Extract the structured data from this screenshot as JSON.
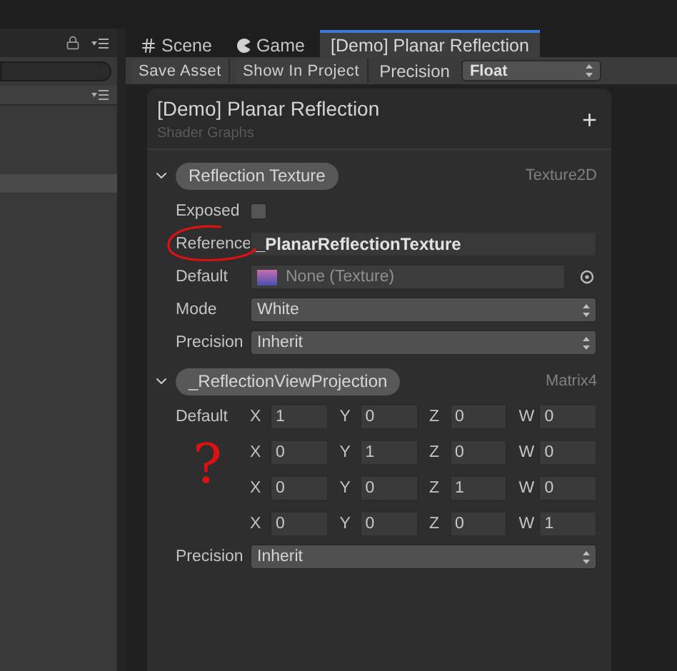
{
  "tabs": [
    {
      "label": "Scene",
      "kind": "scene",
      "selected": false
    },
    {
      "label": "Game",
      "kind": "game",
      "selected": false
    },
    {
      "label": "[Demo] Planar Reflection",
      "kind": "graph",
      "selected": true
    }
  ],
  "toolbar": {
    "buttons": [
      "Save Asset",
      "Show In Project"
    ],
    "precision_label": "Precision",
    "precision_value": "Float"
  },
  "blackboard": {
    "title": "[Demo] Planar Reflection",
    "subtitle": "Shader Graphs",
    "add_label": "+",
    "properties": [
      {
        "name": "Reflection Texture",
        "type": "Texture2D",
        "expanded": true,
        "fields": [
          {
            "kind": "checkbox",
            "label": "Exposed",
            "checked": false
          },
          {
            "kind": "text",
            "label": "Reference",
            "value": "_PlanarReflectionTexture",
            "circled": true
          },
          {
            "kind": "object",
            "label": "Default",
            "value": "None (Texture)"
          },
          {
            "kind": "dropdown",
            "label": "Mode",
            "value": "White"
          },
          {
            "kind": "dropdown",
            "label": "Precision",
            "value": "Inherit"
          }
        ]
      },
      {
        "name": "_ReflectionViewProjection",
        "type": "Matrix4",
        "expanded": true,
        "fields": [
          {
            "kind": "matrix",
            "label": "Default",
            "annotation": "?",
            "rows": [
              [
                {
                  "axis": "X",
                  "value": "1"
                },
                {
                  "axis": "Y",
                  "value": "0"
                },
                {
                  "axis": "Z",
                  "value": "0"
                },
                {
                  "axis": "W",
                  "value": "0"
                }
              ],
              [
                {
                  "axis": "X",
                  "value": "0"
                },
                {
                  "axis": "Y",
                  "value": "1"
                },
                {
                  "axis": "Z",
                  "value": "0"
                },
                {
                  "axis": "W",
                  "value": "0"
                }
              ],
              [
                {
                  "axis": "X",
                  "value": "0"
                },
                {
                  "axis": "Y",
                  "value": "0"
                },
                {
                  "axis": "Z",
                  "value": "1"
                },
                {
                  "axis": "W",
                  "value": "0"
                }
              ],
              [
                {
                  "axis": "X",
                  "value": "0"
                },
                {
                  "axis": "Y",
                  "value": "0"
                },
                {
                  "axis": "Z",
                  "value": "0"
                },
                {
                  "axis": "W",
                  "value": "1"
                }
              ]
            ]
          },
          {
            "kind": "dropdown",
            "label": "Precision",
            "value": "Inherit"
          }
        ]
      }
    ]
  }
}
